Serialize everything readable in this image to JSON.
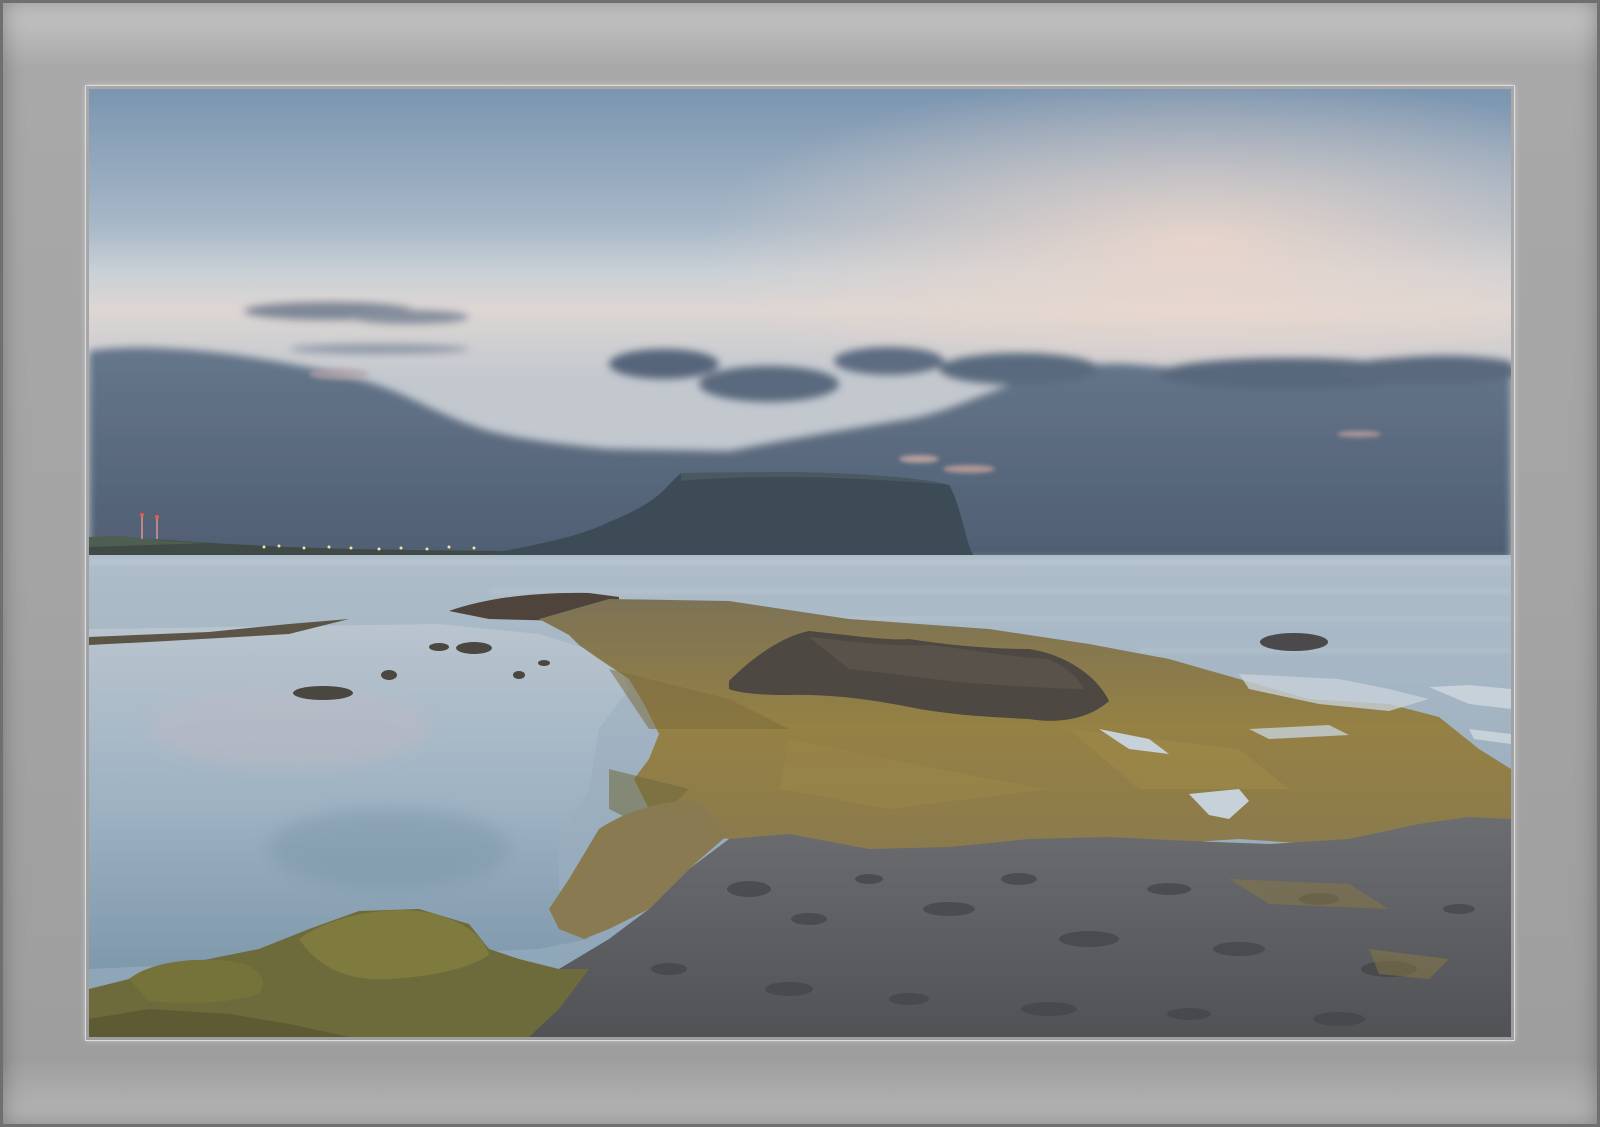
{
  "scene": {
    "subject": "coastal-landscape-at-dusk",
    "colors": {
      "sky_top": "#7d97b1",
      "sky_mid": "#b7c3cf",
      "sky_horizon_glow": "#e6d3c9",
      "cloud_dark": "#55657a",
      "headland": "#3e4d58",
      "sea": "#a3b2bf",
      "moss_rock": "#8d7a45",
      "dark_rock": "#5c5e62",
      "frame_grey": "#a6a6a6"
    }
  }
}
